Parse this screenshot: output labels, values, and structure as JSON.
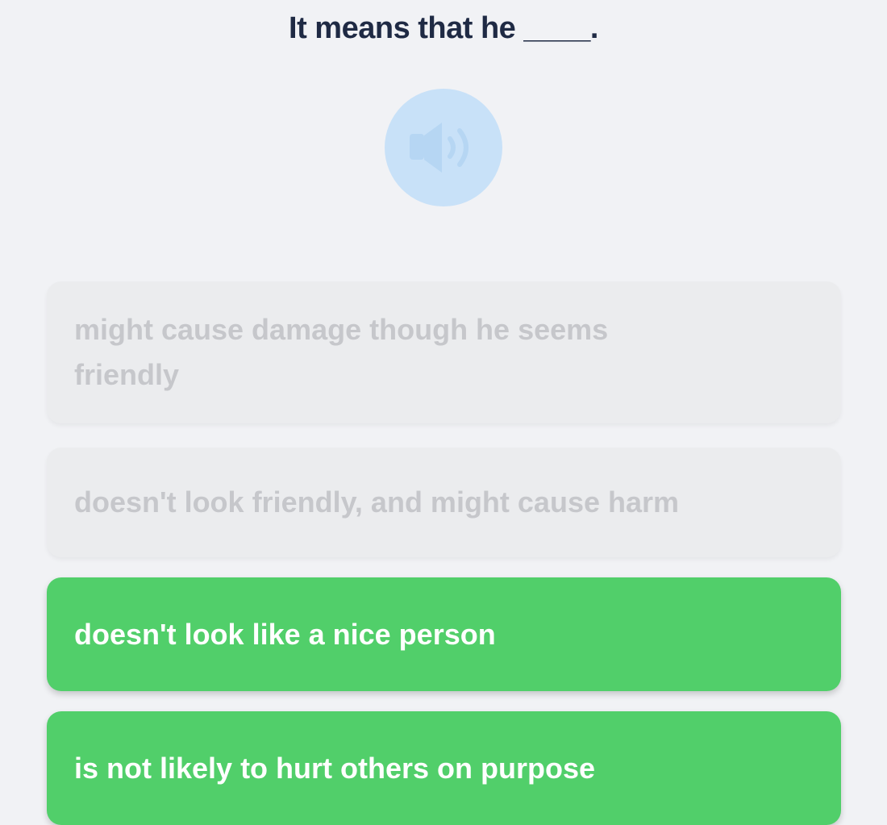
{
  "question": {
    "text": "It means that he ____."
  },
  "audio": {
    "icon": "speaker-icon",
    "color": "#c8e1f8"
  },
  "options": [
    {
      "label": "might cause damage though he seems friendly",
      "state": "disabled"
    },
    {
      "label": "doesn't look friendly, and might cause harm",
      "state": "disabled"
    },
    {
      "label": "doesn't look like a nice person",
      "state": "correct"
    },
    {
      "label": "is not likely to hurt others on purpose",
      "state": "correct"
    }
  ],
  "colors": {
    "background": "#f1f2f5",
    "correct": "#51cf6a",
    "disabled": "#ebecee",
    "question_text": "#1f2a44"
  }
}
